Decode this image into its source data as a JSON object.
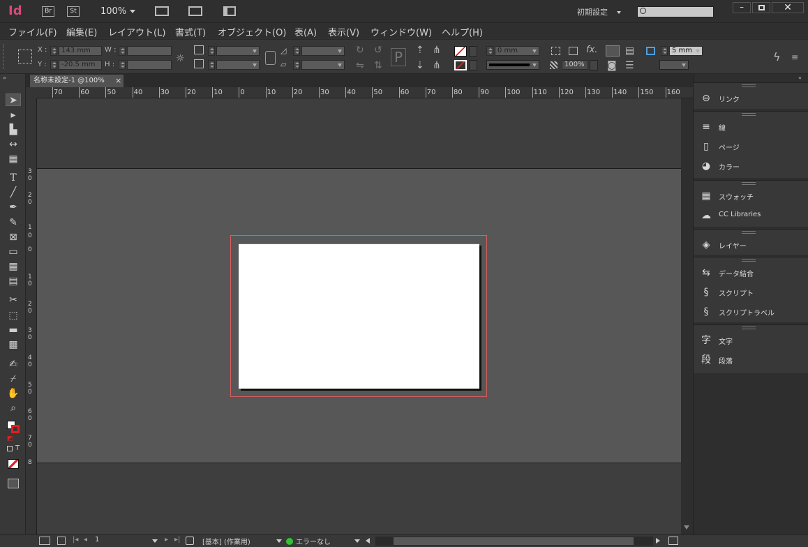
{
  "app": {
    "logo": "Id",
    "bridge": "Br",
    "stock": "St",
    "zoom": "100%",
    "workspace": "初期設定",
    "search_placeholder": ""
  },
  "menu": [
    "ファイル(F)",
    "編集(E)",
    "レイアウト(L)",
    "書式(T)",
    "オブジェクト(O)",
    "表(A)",
    "表示(V)",
    "ウィンドウ(W)",
    "ヘルプ(H)"
  ],
  "control": {
    "x_label": "X :",
    "y_label": "Y :",
    "w_label": "W :",
    "h_label": "H :",
    "x_value": "143 mm",
    "y_value": "-20.5 mm",
    "stroke_weight": "0 mm",
    "opacity": "100%",
    "spacing": "5 mm"
  },
  "document": {
    "tab_title": "名称未設定-1 @100%",
    "close": "×"
  },
  "ruler": {
    "h_ticks": [
      "70",
      "60",
      "50",
      "40",
      "30",
      "20",
      "10",
      "0",
      "10",
      "20",
      "30",
      "40",
      "50",
      "60",
      "70",
      "80",
      "90",
      "100",
      "110",
      "120",
      "130",
      "140",
      "150",
      "160"
    ],
    "v_ticks": [
      "3",
      "0",
      "2",
      "0",
      "1",
      "0",
      "0",
      "1",
      "0",
      "2",
      "0",
      "3",
      "0",
      "4",
      "0",
      "5",
      "0",
      "6",
      "0",
      "7",
      "0",
      "8"
    ]
  },
  "panels": {
    "groups": [
      [
        {
          "icon": "link-icon",
          "label": "リンク"
        }
      ],
      [
        {
          "icon": "stroke-icon",
          "label": "線"
        },
        {
          "icon": "pages-icon",
          "label": "ページ"
        },
        {
          "icon": "color-icon",
          "label": "カラー"
        }
      ],
      [
        {
          "icon": "swatches-icon",
          "label": "スウォッチ"
        },
        {
          "icon": "cc-libraries-icon",
          "label": "CC Libraries"
        }
      ],
      [
        {
          "icon": "layers-icon",
          "label": "レイヤー"
        }
      ],
      [
        {
          "icon": "data-merge-icon",
          "label": "データ結合"
        },
        {
          "icon": "scripts-icon",
          "label": "スクリプト"
        },
        {
          "icon": "script-label-icon",
          "label": "スクリプトラベル"
        }
      ],
      [
        {
          "icon": "character-icon",
          "label": "文字"
        },
        {
          "icon": "paragraph-icon",
          "label": "段落"
        }
      ]
    ]
  },
  "status": {
    "page": "1",
    "style": "[基本] (作業用)",
    "preflight": "エラーなし"
  },
  "colors": {
    "bleed": "#d95e5e",
    "preflight_ok": "#35c135"
  }
}
